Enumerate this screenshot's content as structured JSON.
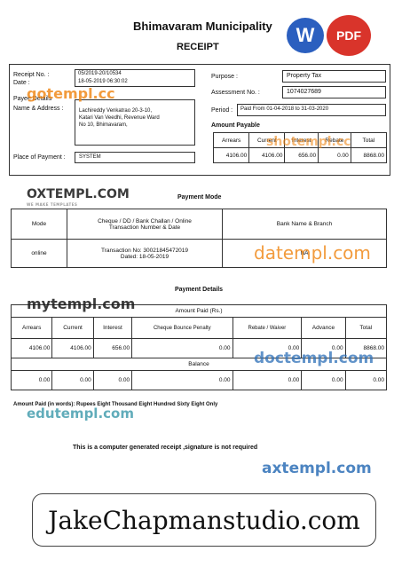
{
  "header": {
    "title": "Bhimavaram Municipality",
    "subtitle": "RECEIPT",
    "word_badge": "W",
    "pdf_badge": "PDF"
  },
  "receipt": {
    "receipt_no_label": "Receipt No. :",
    "receipt_no": "05/2019-20/10534",
    "date_label": "Date :",
    "date": "18-05-2019 06:30:02",
    "payee_label": "Payee Details",
    "name_label": "Name & Address :",
    "address_line1": "Lachireddy Venkatrao 20-3-10,",
    "address_line2": "Katari Van Veedhi, Revenue Ward",
    "address_line3": "No 10, Bhimavaram,",
    "place_label": "Place of Payment :",
    "place_value": "SYSTEM",
    "purpose_label": "Purpose :",
    "purpose_value": "Property Tax",
    "assessment_label": "Assessment No. :",
    "assessment_value": "1074027689",
    "period_label": "Period :",
    "period_value": "Paid From 01-04-2018 to 31-03-2020",
    "amount_payable_label": "Amount Payable",
    "payable_headers": [
      "Arrears",
      "Current",
      "Interest",
      "Rebate",
      "Total"
    ],
    "payable_values": [
      "4106.00",
      "4106.00",
      "656.00",
      "0.00",
      "8868.00"
    ]
  },
  "payment_mode": {
    "title": "Payment Mode",
    "col_mode": "Mode",
    "col_txn_line1": "Cheque / DD / Bank Challan / Online",
    "col_txn_line2": "Transaction Number & Date",
    "col_bank": "Bank Name & Branch",
    "mode_value": "online",
    "txn_line1": "Transaction No: 30021845472019",
    "txn_line2": "Dated: 18-05-2019",
    "bank_value": "NA"
  },
  "payment_details": {
    "title": "Payment Details",
    "amount_paid_label": "Amount Paid (Rs.)",
    "headers": [
      "Arrears",
      "Current",
      "Interest",
      "Cheque Bounce Penalty",
      "Rebate / Waiver",
      "Advance",
      "Total"
    ],
    "values": [
      "4106.00",
      "4106.00",
      "656.00",
      "0.00",
      "0.00",
      "0.00",
      "8868.00"
    ],
    "balance_label": "Balance",
    "balance_values": [
      "0.00",
      "0.00",
      "0.00",
      "0.00",
      "0.00",
      "0.00",
      "0.00"
    ]
  },
  "footer": {
    "amount_words": "Amount Paid (in words): Rupees Eight Thousand Eight Hundred Sixty Eight Only",
    "computer_note": "This is a computer generated receipt ,signature is not required",
    "banner_text": "JakeChapmanstudio.com"
  },
  "watermarks": {
    "gotempl": "gotempl.cc",
    "shotempl": "shotempl.cc",
    "oxtempl": "OXTEMPL.COM",
    "oxtempl_sub": "WE MAKE TEMPLATES",
    "datempl": "datempl.com",
    "mytempl": "mytempl.com",
    "doctempl": "doctempl.com",
    "edutempl": "edutempl.com",
    "axtempl": "axtempl.com"
  },
  "colors": {
    "word_blue": "#2b5fbf",
    "pdf_red": "#d9342b",
    "wm_orange": "#f08a1c",
    "wm_blue": "#2d6fb7",
    "wm_teal": "#1f8a9e"
  }
}
